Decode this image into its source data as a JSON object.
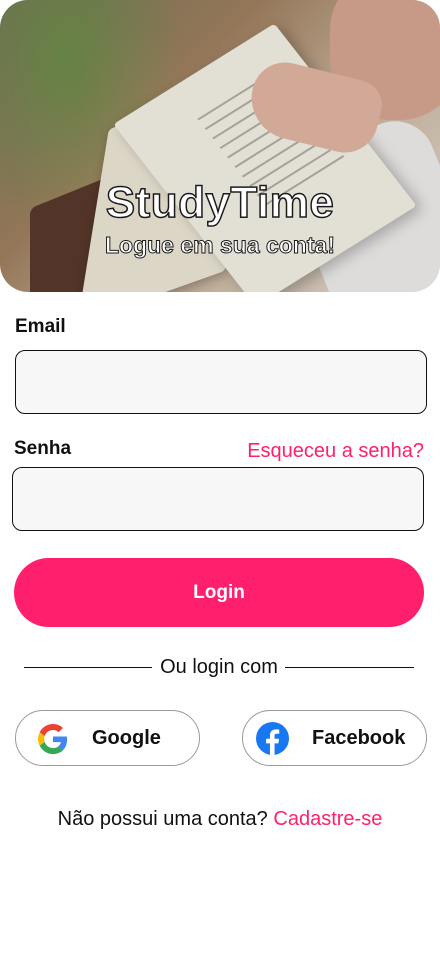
{
  "hero": {
    "title": "StudyTime",
    "subtitle": "Logue em sua conta!"
  },
  "form": {
    "email_label": "Email",
    "email_value": "",
    "password_label": "Senha",
    "password_value": "",
    "forgot_password": "Esqueceu a senha?"
  },
  "actions": {
    "login_label": "Login",
    "divider_text": "Ou login com",
    "google_label": "Google",
    "facebook_label": "Facebook"
  },
  "signup": {
    "prompt": "Não possui uma conta?",
    "link": "Cadastre-se"
  },
  "colors": {
    "accent": "#ff1f6c",
    "field_bg": "#f7f7f7",
    "facebook": "#1877f2"
  },
  "icons": {
    "google": "google-icon",
    "facebook": "facebook-icon"
  }
}
